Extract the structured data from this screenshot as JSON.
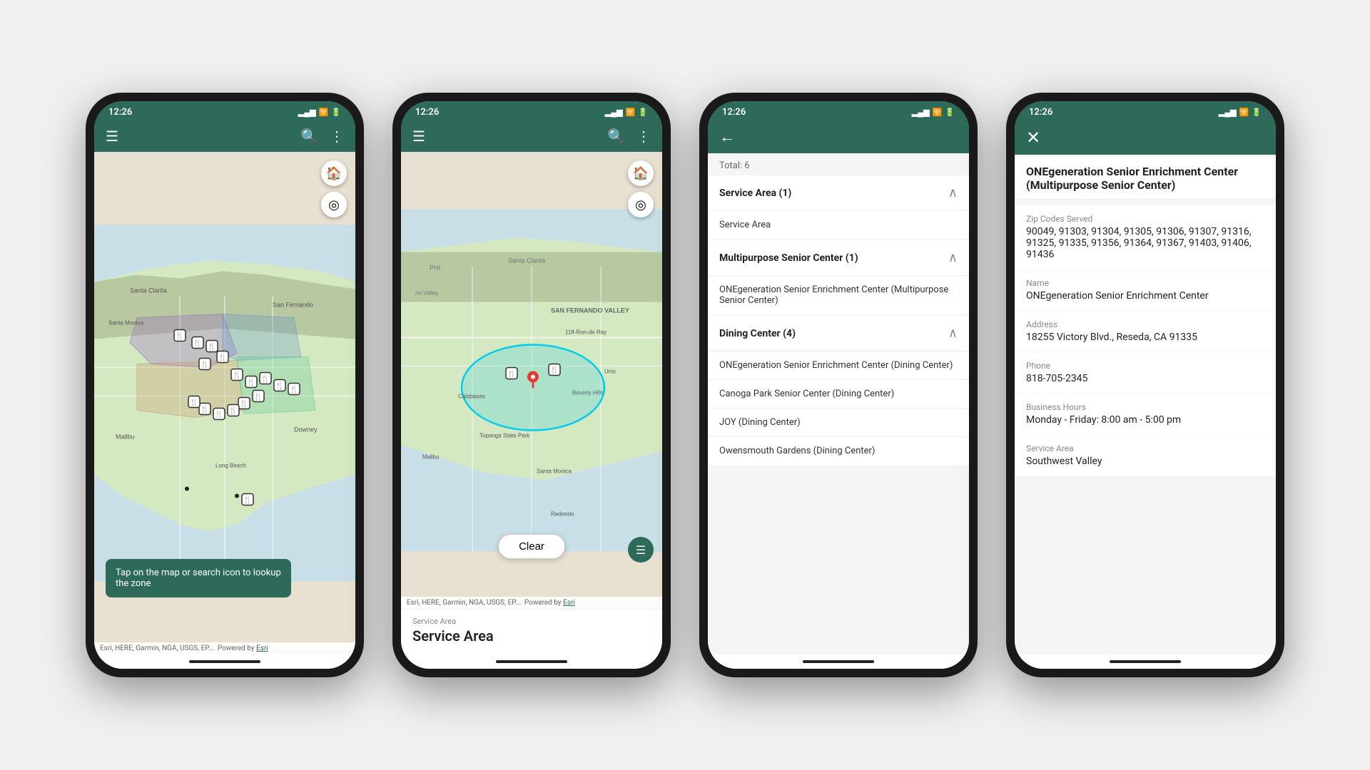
{
  "phones": [
    {
      "id": "phone1",
      "status_time": "12:26",
      "header": {
        "menu_icon": "☰",
        "search_icon": "🔍",
        "more_icon": "⋮"
      },
      "tooltip": "Tap on the map or search icon to lookup the zone",
      "footer": "Esri, HERE, Garmin, NGA, USGS, EP...",
      "footer_link": "Esri",
      "powered_by": "Powered by"
    },
    {
      "id": "phone2",
      "status_time": "12:26",
      "header": {
        "menu_icon": "☰",
        "search_icon": "🔍",
        "more_icon": "⋮"
      },
      "clear_btn": "Clear",
      "service_area_label": "Service Area",
      "service_area_value": "Service Area",
      "footer": "Esri, HERE, Garmin, NGA, USGS, EP...",
      "footer_link": "Esri",
      "powered_by": "Powered by"
    },
    {
      "id": "phone3",
      "status_time": "12:26",
      "back_icon": "←",
      "total": "Total: 6",
      "sections": [
        {
          "title": "Service Area (1)",
          "items": [
            "Service Area"
          ]
        },
        {
          "title": "Multipurpose Senior Center (1)",
          "items": [
            "ONEgeneration Senior Enrichment Center (Multipurpose Senior Center)"
          ]
        },
        {
          "title": "Dining Center (4)",
          "items": [
            "ONEgeneration Senior Enrichment Center (Dining Center)",
            "Canoga Park Senior Center (Dining Center)",
            "JOY (Dining Center)",
            "Owensmouth Gardens (Dining Center)"
          ]
        }
      ]
    },
    {
      "id": "phone4",
      "status_time": "12:26",
      "close_icon": "✕",
      "detail": {
        "title": "ONEgeneration Senior Enrichment Center (Multipurpose Senior Center)",
        "fields": [
          {
            "label": "Zip Codes Served",
            "value": "90049, 91303, 91304, 91305, 91306, 91307, 91316, 91325, 91335, 91356, 91364, 91367, 91403, 91406, 91436"
          },
          {
            "label": "Name",
            "value": "ONEgeneration Senior Enrichment Center"
          },
          {
            "label": "Address",
            "value": "18255 Victory Blvd., Reseda, CA 91335"
          },
          {
            "label": "Phone",
            "value": "818-705-2345"
          },
          {
            "label": "Business Hours",
            "value": "Monday - Friday: 8:00 am - 5:00 pm"
          },
          {
            "label": "Service Area",
            "value": "Southwest Valley"
          }
        ]
      }
    }
  ],
  "colors": {
    "header_bg": "#2d6a5a",
    "accent": "#2d6a5a"
  }
}
